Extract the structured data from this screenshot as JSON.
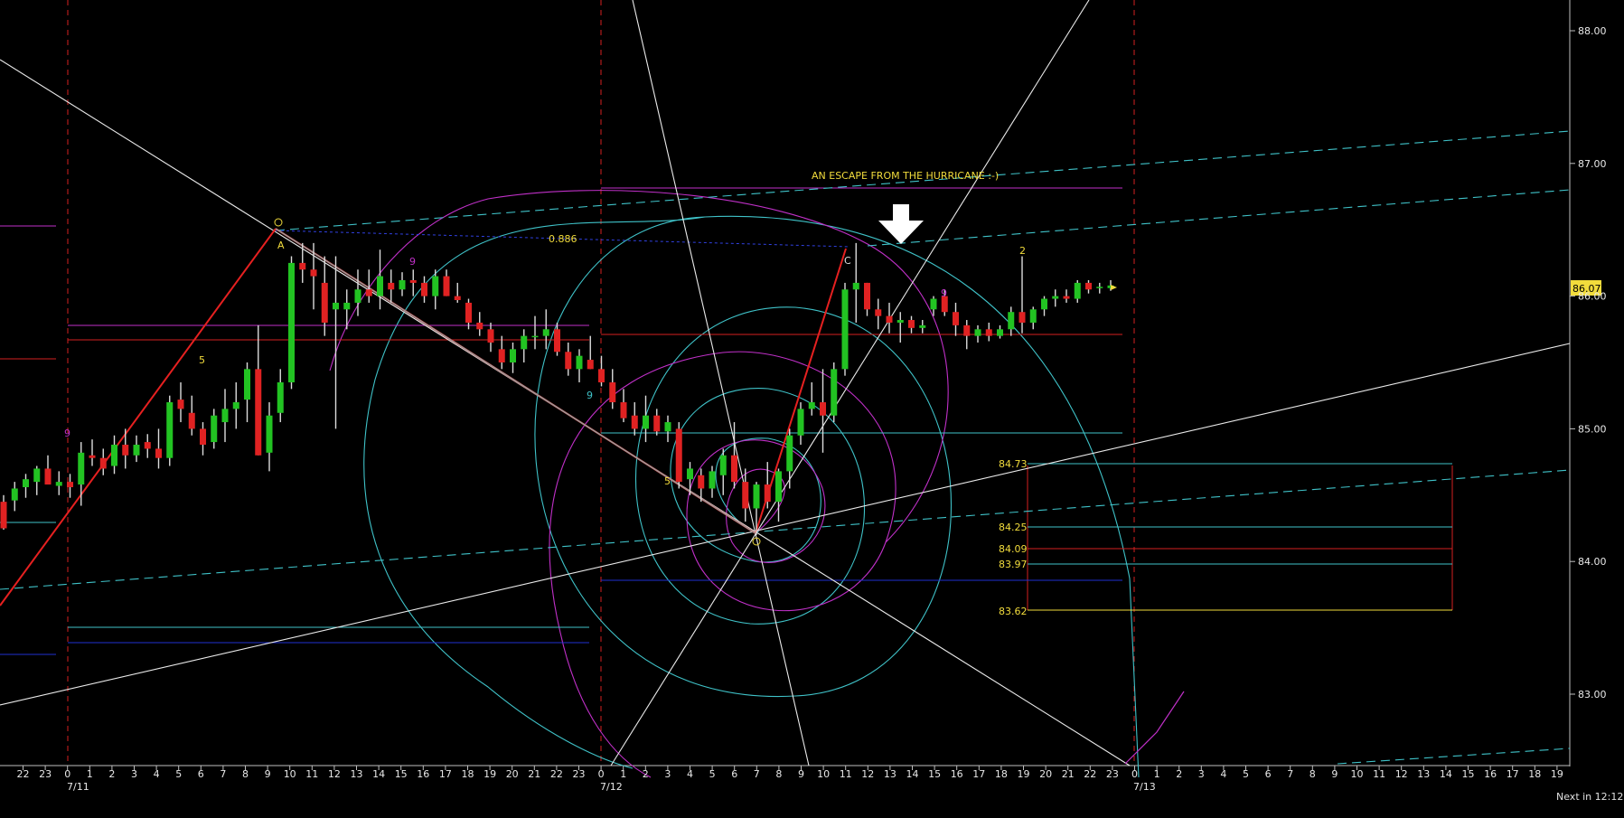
{
  "chart_data": {
    "type": "candlestick",
    "y_axis": {
      "ticks": [
        88.0,
        87.0,
        86.0,
        85.0,
        84.0,
        83.0
      ],
      "tick_labels": [
        "88.00",
        "87.00",
        "86.00",
        "85.00",
        "84.00",
        "83.00"
      ],
      "ylim": [
        82.45,
        88.2
      ]
    },
    "x_axis": {
      "hour_labels": [
        "22",
        "23",
        "0",
        "1",
        "2",
        "3",
        "4",
        "5",
        "6",
        "7",
        "8",
        "9",
        "10",
        "11",
        "12",
        "13",
        "14",
        "15",
        "16",
        "17",
        "18",
        "19",
        "20",
        "21",
        "22",
        "23",
        "0",
        "1",
        "2",
        "3",
        "4",
        "5",
        "6",
        "7",
        "8",
        "9",
        "10",
        "11",
        "12",
        "13",
        "14",
        "15",
        "16",
        "17",
        "18",
        "19",
        "20",
        "21",
        "22",
        "23",
        "0",
        "1",
        "2",
        "3",
        "4",
        "5",
        "6",
        "7",
        "8",
        "9",
        "10",
        "11",
        "12",
        "13",
        "14",
        "15",
        "16",
        "17",
        "18",
        "19"
      ],
      "day_labels": [
        "7/11",
        "7/12",
        "7/13"
      ]
    },
    "current_price": "86.07",
    "annotation_text": "AN ESCAPE FROM THE HURRICANE :-)",
    "fib_ratio": "0.886",
    "point_labels": [
      "A",
      "C",
      "9",
      "9",
      "9",
      "9",
      "5",
      "5",
      "2"
    ],
    "level_labels": [
      "84.73",
      "84.25",
      "84.09",
      "83.97",
      "83.62"
    ],
    "footer_text": "Next in 12:12",
    "colors": {
      "up": "#22c322",
      "down": "#e02222",
      "wick": "#dcdcdc",
      "spiral_cyan": "#3fc2c8",
      "spiral_magenta": "#c030c8",
      "trend": "#e62020",
      "text_yellow": "#f2dc3c"
    },
    "candles": [
      [
        84.45,
        84.5,
        84.24,
        84.25
      ],
      [
        84.46,
        84.6,
        84.38,
        84.55
      ],
      [
        84.56,
        84.66,
        84.48,
        84.62
      ],
      [
        84.6,
        84.72,
        84.5,
        84.7
      ],
      [
        84.7,
        84.8,
        84.6,
        84.58
      ],
      [
        84.57,
        84.68,
        84.5,
        84.6
      ],
      [
        84.6,
        84.66,
        84.48,
        84.56
      ],
      [
        84.58,
        84.9,
        84.42,
        84.82
      ],
      [
        84.8,
        84.92,
        84.72,
        84.78
      ],
      [
        84.78,
        84.85,
        84.65,
        84.7
      ],
      [
        84.72,
        84.95,
        84.66,
        84.88
      ],
      [
        84.88,
        85.0,
        84.7,
        84.8
      ],
      [
        84.8,
        84.95,
        84.75,
        84.88
      ],
      [
        84.9,
        84.96,
        84.78,
        84.85
      ],
      [
        84.85,
        85.0,
        84.7,
        84.78
      ],
      [
        84.78,
        85.25,
        84.72,
        85.2
      ],
      [
        85.22,
        85.35,
        85.05,
        85.15
      ],
      [
        85.12,
        85.25,
        84.95,
        85.0
      ],
      [
        85.0,
        85.05,
        84.8,
        84.88
      ],
      [
        84.9,
        85.15,
        84.85,
        85.1
      ],
      [
        85.05,
        85.3,
        84.9,
        85.15
      ],
      [
        85.15,
        85.35,
        85.0,
        85.2
      ],
      [
        85.22,
        85.5,
        85.05,
        85.45
      ],
      [
        85.45,
        85.78,
        84.8,
        84.8
      ],
      [
        84.82,
        85.2,
        84.68,
        85.1
      ],
      [
        85.12,
        85.45,
        85.05,
        85.35
      ],
      [
        85.35,
        86.3,
        85.3,
        86.25
      ],
      [
        86.25,
        86.4,
        86.1,
        86.2
      ],
      [
        86.2,
        86.4,
        85.9,
        86.15
      ],
      [
        86.1,
        86.3,
        85.7,
        85.8
      ],
      [
        85.9,
        86.3,
        85.0,
        85.95
      ],
      [
        85.9,
        86.05,
        85.75,
        85.95
      ],
      [
        85.95,
        86.2,
        85.85,
        86.05
      ],
      [
        86.05,
        86.2,
        85.95,
        86.0
      ],
      [
        86.0,
        86.35,
        85.9,
        86.15
      ],
      [
        86.1,
        86.2,
        85.95,
        86.05
      ],
      [
        86.05,
        86.18,
        86.0,
        86.12
      ],
      [
        86.12,
        86.2,
        86.0,
        86.1
      ],
      [
        86.1,
        86.15,
        85.95,
        86.0
      ],
      [
        86.0,
        86.2,
        85.9,
        86.15
      ],
      [
        86.15,
        86.2,
        86.0,
        86.0
      ],
      [
        86.0,
        86.1,
        85.95,
        85.97
      ],
      [
        85.95,
        85.98,
        85.75,
        85.8
      ],
      [
        85.8,
        85.88,
        85.7,
        85.75
      ],
      [
        85.75,
        85.8,
        85.58,
        85.65
      ],
      [
        85.6,
        85.7,
        85.45,
        85.5
      ],
      [
        85.5,
        85.65,
        85.42,
        85.6
      ],
      [
        85.6,
        85.75,
        85.5,
        85.7
      ],
      [
        85.7,
        85.85,
        85.6,
        85.7
      ],
      [
        85.7,
        85.9,
        85.6,
        85.75
      ],
      [
        85.75,
        85.8,
        85.55,
        85.58
      ],
      [
        85.58,
        85.65,
        85.4,
        85.45
      ],
      [
        85.45,
        85.6,
        85.35,
        85.55
      ],
      [
        85.52,
        85.7,
        85.45,
        85.45
      ],
      [
        85.45,
        85.55,
        85.32,
        85.35
      ],
      [
        85.35,
        85.45,
        85.15,
        85.2
      ],
      [
        85.2,
        85.3,
        85.05,
        85.08
      ],
      [
        85.1,
        85.2,
        84.95,
        85.0
      ],
      [
        85.0,
        85.25,
        84.9,
        85.1
      ],
      [
        85.1,
        85.15,
        84.95,
        84.98
      ],
      [
        84.98,
        85.1,
        84.9,
        85.05
      ],
      [
        85.0,
        85.05,
        84.55,
        84.6
      ],
      [
        84.62,
        84.75,
        84.5,
        84.7
      ],
      [
        84.65,
        84.7,
        84.45,
        84.55
      ],
      [
        84.55,
        84.72,
        84.48,
        84.68
      ],
      [
        84.65,
        84.85,
        84.5,
        84.8
      ],
      [
        84.8,
        85.05,
        84.55,
        84.6
      ],
      [
        84.6,
        84.7,
        84.3,
        84.4
      ],
      [
        84.4,
        84.6,
        84.2,
        84.58
      ],
      [
        84.58,
        84.75,
        84.4,
        84.45
      ],
      [
        84.45,
        84.7,
        84.3,
        84.68
      ],
      [
        84.68,
        85.0,
        84.55,
        84.95
      ],
      [
        84.95,
        85.2,
        84.88,
        85.15
      ],
      [
        85.15,
        85.35,
        85.1,
        85.2
      ],
      [
        85.2,
        85.45,
        84.82,
        85.1
      ],
      [
        85.1,
        85.5,
        85.05,
        85.45
      ],
      [
        85.45,
        86.1,
        85.4,
        86.05
      ],
      [
        86.05,
        86.4,
        85.8,
        86.1
      ],
      [
        86.1,
        86.1,
        85.85,
        85.9
      ],
      [
        85.9,
        85.98,
        85.75,
        85.85
      ],
      [
        85.85,
        85.95,
        85.72,
        85.8
      ],
      [
        85.8,
        85.88,
        85.65,
        85.82
      ],
      [
        85.82,
        85.85,
        85.72,
        85.76
      ],
      [
        85.76,
        85.82,
        85.72,
        85.78
      ],
      [
        85.9,
        86.0,
        85.85,
        85.98
      ],
      [
        86.0,
        86.05,
        85.85,
        85.88
      ],
      [
        85.88,
        85.95,
        85.7,
        85.78
      ],
      [
        85.78,
        85.82,
        85.6,
        85.7
      ],
      [
        85.7,
        85.78,
        85.65,
        85.75
      ],
      [
        85.75,
        85.8,
        85.66,
        85.7
      ],
      [
        85.7,
        85.78,
        85.68,
        85.75
      ],
      [
        85.75,
        85.92,
        85.7,
        85.88
      ],
      [
        85.88,
        86.3,
        85.72,
        85.8
      ],
      [
        85.8,
        85.92,
        85.75,
        85.9
      ],
      [
        85.9,
        86.0,
        85.85,
        85.98
      ],
      [
        85.98,
        86.05,
        85.92,
        86.0
      ],
      [
        86.0,
        86.05,
        85.95,
        85.98
      ],
      [
        85.98,
        86.12,
        85.95,
        86.1
      ],
      [
        86.1,
        86.12,
        86.02,
        86.05
      ],
      [
        86.06,
        86.1,
        86.02,
        86.07
      ],
      [
        86.06,
        86.12,
        86.04,
        86.08
      ]
    ]
  }
}
